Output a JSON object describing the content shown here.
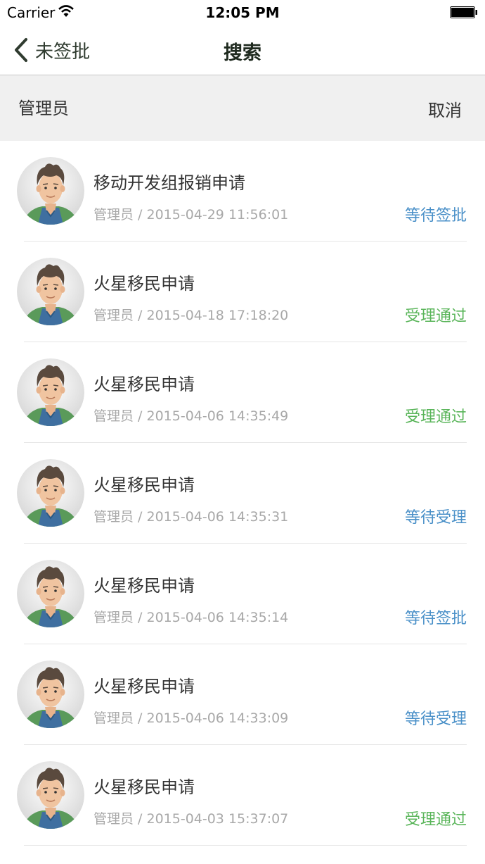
{
  "status_bar": {
    "carrier": "Carrier",
    "time": "12:05 PM"
  },
  "nav": {
    "back_label": "未签批",
    "title": "搜索"
  },
  "search": {
    "value": "管理员",
    "cancel_label": "取消"
  },
  "colors": {
    "waiting": "#4a90c8",
    "approved": "#5ab55a"
  },
  "items": [
    {
      "title": "移动开发组报销申请",
      "meta": "管理员 / 2015-04-29 11:56:01",
      "status": "等待签批",
      "status_type": "waiting"
    },
    {
      "title": "火星移民申请",
      "meta": "管理员 / 2015-04-18 17:18:20",
      "status": "受理通过",
      "status_type": "approved"
    },
    {
      "title": "火星移民申请",
      "meta": "管理员 / 2015-04-06 14:35:49",
      "status": "受理通过",
      "status_type": "approved"
    },
    {
      "title": "火星移民申请",
      "meta": "管理员 / 2015-04-06 14:35:31",
      "status": "等待受理",
      "status_type": "waiting"
    },
    {
      "title": "火星移民申请",
      "meta": "管理员 / 2015-04-06 14:35:14",
      "status": "等待签批",
      "status_type": "waiting"
    },
    {
      "title": "火星移民申请",
      "meta": "管理员 / 2015-04-06 14:33:09",
      "status": "等待受理",
      "status_type": "waiting"
    },
    {
      "title": "火星移民申请",
      "meta": "管理员 / 2015-04-03 15:37:07",
      "status": "受理通过",
      "status_type": "approved"
    }
  ]
}
